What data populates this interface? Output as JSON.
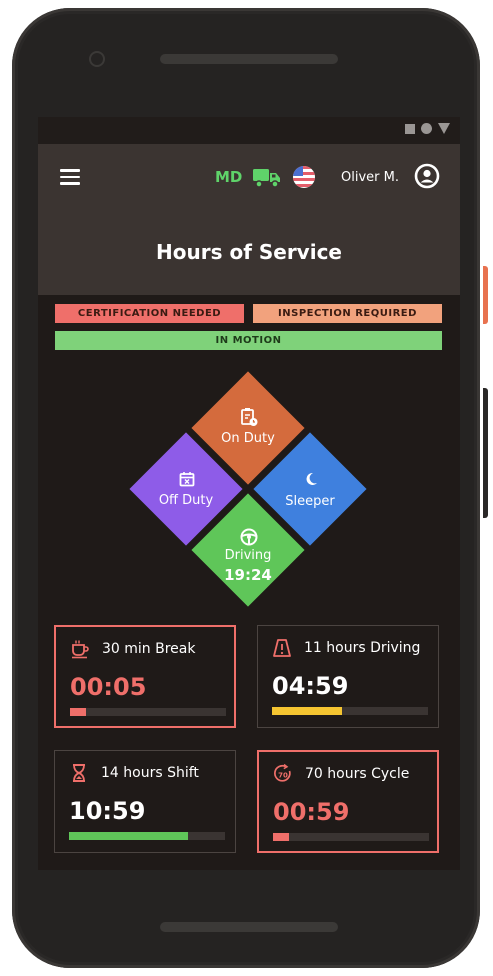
{
  "colors": {
    "alert": "#ef6f6a",
    "driving_bar": "#f5c531",
    "shift_bar": "#5fc659",
    "md": "#5fd36a",
    "on_duty": "#d46b3d",
    "off_duty": "#8e5ce8",
    "sleeper": "#3f80de",
    "driving": "#5fc659"
  },
  "header": {
    "menu_icon": "hamburger-menu-icon",
    "state_code": "MD",
    "truck_icon": "truck-icon",
    "flag_icon": "us-flag-icon",
    "user_name": "Oliver M.",
    "user_icon": "user-account-icon",
    "title": "Hours of Service"
  },
  "badges": {
    "certification": "CERTIFICATION NEEDED",
    "inspection": "INSPECTION REQUIRED",
    "motion": "IN MOTION"
  },
  "duty_status": {
    "on_duty": {
      "label": "On Duty",
      "icon": "clipboard-clock-icon"
    },
    "off_duty": {
      "label": "Off Duty",
      "icon": "calendar-x-icon"
    },
    "sleeper": {
      "label": "Sleeper",
      "icon": "moon-icon"
    },
    "driving": {
      "label": "Driving",
      "time": "19:24",
      "icon": "steering-wheel-icon"
    }
  },
  "timers": [
    {
      "title": "30 min Break",
      "value": "00:05",
      "progress": 0.1,
      "icon": "coffee-cup-icon",
      "alert": true
    },
    {
      "title": "11 hours Driving",
      "value": "04:59",
      "progress": 0.45,
      "icon": "road-warning-icon",
      "alert": false
    },
    {
      "title": "14 hours Shift",
      "value": "10:59",
      "progress": 0.76,
      "icon": "hourglass-icon",
      "alert": false
    },
    {
      "title": "70 hours Cycle",
      "value": "00:59",
      "progress": 0.1,
      "icon": "cycle-70-icon",
      "alert": true
    }
  ]
}
